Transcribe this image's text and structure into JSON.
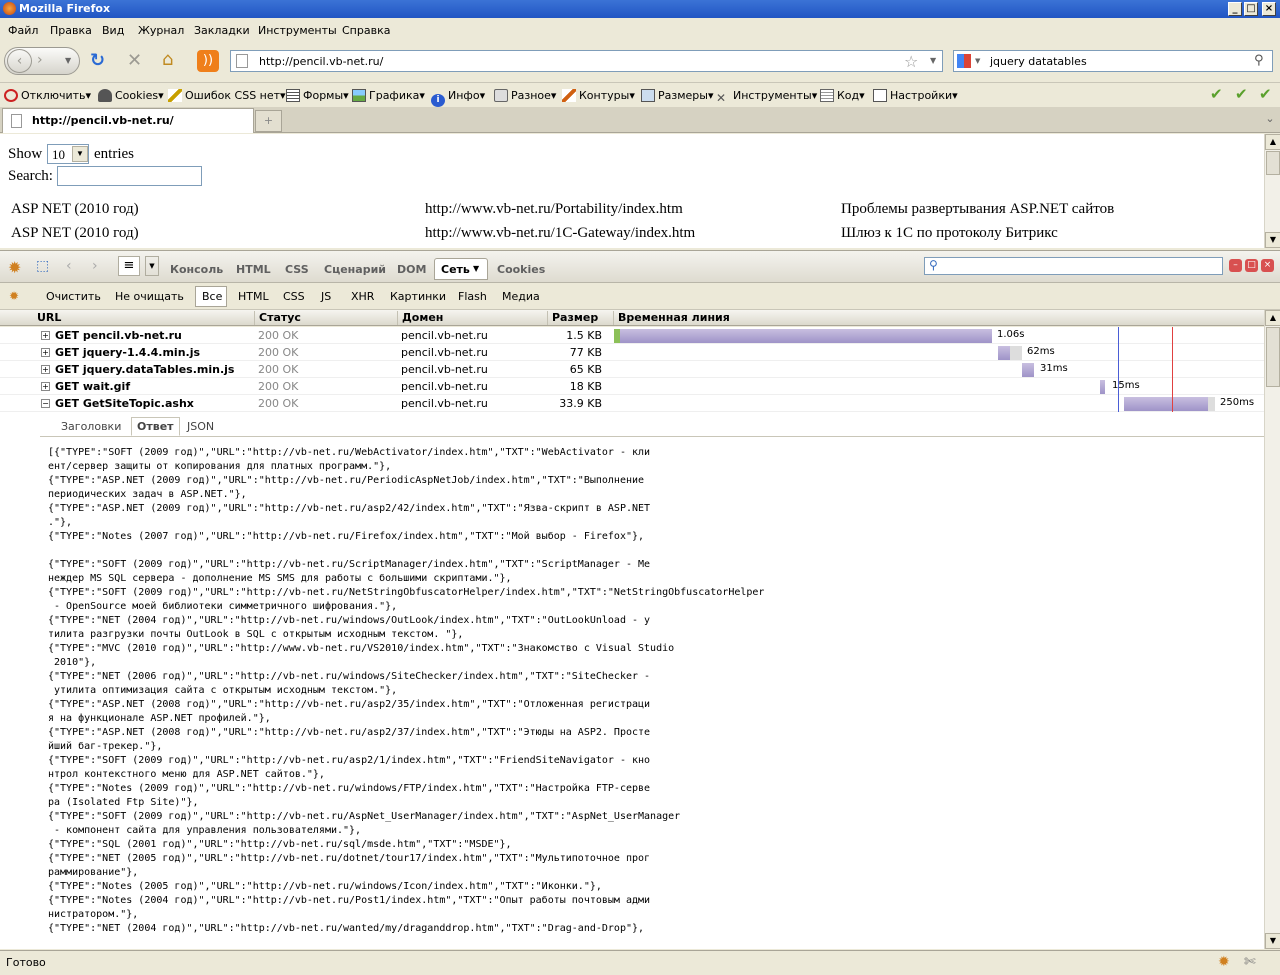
{
  "window": {
    "title": "Mozilla Firefox"
  },
  "menu": [
    "Файл",
    "Правка",
    "Вид",
    "Журнал",
    "Закладки",
    "Инструменты",
    "Справка"
  ],
  "nav": {
    "url": "http://pencil.vb-net.ru/",
    "search": "jquery datatables"
  },
  "toolbar2": [
    "Отключить",
    "Cookies",
    "Ошибок CSS нет",
    "Формы",
    "Графика",
    "Инфо",
    "Разное",
    "Контуры",
    "Размеры",
    "Инструменты",
    "Код",
    "Настройки"
  ],
  "tab": {
    "label": "http://pencil.vb-net.ru/"
  },
  "page": {
    "show": "Show",
    "entries": "entries",
    "select_value": "10",
    "search_label": "Search:",
    "rows": [
      [
        "ASP NET (2010 год)",
        "http://www.vb-net.ru/Portability/index.htm",
        "Проблемы развертывания ASP.NET сайтов"
      ],
      [
        "ASP NET (2010 год)",
        "http://www.vb-net.ru/1C-Gateway/index.htm",
        "Шлюз к 1C по протоколу Битрикс"
      ]
    ]
  },
  "firebug": {
    "tabs": [
      "Консоль",
      "HTML",
      "CSS",
      "Сценарий",
      "DOM",
      "Сеть",
      "Cookies"
    ],
    "active_tab": "Сеть",
    "filters": [
      "Очистить",
      "Не очищать",
      "Все",
      "HTML",
      "CSS",
      "JS",
      "XHR",
      "Картинки",
      "Flash",
      "Медиа"
    ],
    "columns": [
      "URL",
      "Статус",
      "Домен",
      "Размер",
      "Временная линия"
    ],
    "requests": [
      {
        "url": "GET pencil.vb-net.ru",
        "status": "200 OK",
        "domain": "pencil.vb-net.ru",
        "size": "1.5 KB",
        "time": "1.06s",
        "sign": "+"
      },
      {
        "url": "GET jquery-1.4.4.min.js",
        "status": "200 OK",
        "domain": "pencil.vb-net.ru",
        "size": "77 KB",
        "time": "62ms",
        "sign": "+"
      },
      {
        "url": "GET jquery.dataTables.min.js",
        "status": "200 OK",
        "domain": "pencil.vb-net.ru",
        "size": "65 KB",
        "time": "31ms",
        "sign": "+"
      },
      {
        "url": "GET wait.gif",
        "status": "200 OK",
        "domain": "pencil.vb-net.ru",
        "size": "18 KB",
        "time": "15ms",
        "sign": "+"
      },
      {
        "url": "GET GetSiteTopic.ashx",
        "status": "200 OK",
        "domain": "pencil.vb-net.ru",
        "size": "33.9 KB",
        "time": "250ms",
        "sign": "−"
      }
    ],
    "subtabs": [
      "Заголовки",
      "Ответ",
      "JSON"
    ],
    "response": "[{\"TYPE\":\"SOFT (2009 год)\",\"URL\":\"http://vb-net.ru/WebActivator/index.htm\",\"TXT\":\"WebActivator - кли\nент/сервер защиты от копирования для платных программ.\"},\n{\"TYPE\":\"ASP.NET (2009 год)\",\"URL\":\"http://vb-net.ru/PeriodicAspNetJob/index.htm\",\"TXT\":\"Выполнение\nпериодических задач в ASP.NET.\"},\n{\"TYPE\":\"ASP.NET (2009 год)\",\"URL\":\"http://vb-net.ru/asp2/42/index.htm\",\"TXT\":\"Язва-скрипт в ASP.NET\n.\"},\n{\"TYPE\":\"Notes (2007 год)\",\"URL\":\"http://vb-net.ru/Firefox/index.htm\",\"TXT\":\"Мой выбор - Firefox\"},\n\n{\"TYPE\":\"SOFT (2009 год)\",\"URL\":\"http://vb-net.ru/ScriptManager/index.htm\",\"TXT\":\"ScriptManager - Ме\nнеждер MS SQL сервера - дополнение MS SMS для работы с большими скриптами.\"},\n{\"TYPE\":\"SOFT (2009 год)\",\"URL\":\"http://vb-net.ru/NetStringObfuscatorHelper/index.htm\",\"TXT\":\"NetStringObfuscatorHelper\n - OpenSource моей библиотеки симметричного шифрования.\"},\n{\"TYPE\":\"NET (2004 год)\",\"URL\":\"http://vb-net.ru/windows/OutLook/index.htm\",\"TXT\":\"OutLookUnload - у\nтилита разгрузки почты OutLook в SQL с открытым исходным текстом. \"},\n{\"TYPE\":\"MVC (2010 год)\",\"URL\":\"http://www.vb-net.ru/VS2010/index.htm\",\"TXT\":\"Знакомство с Visual Studio\n 2010\"},\n{\"TYPE\":\"NET (2006 год)\",\"URL\":\"http://vb-net.ru/windows/SiteChecker/index.htm\",\"TXT\":\"SiteChecker -\n утилита оптимизация сайта с открытым исходным текстом.\"},\n{\"TYPE\":\"ASP.NET (2008 год)\",\"URL\":\"http://vb-net.ru/asp2/35/index.htm\",\"TXT\":\"Отложенная регистраци\nя на функционале ASP.NET профилей.\"},\n{\"TYPE\":\"ASP.NET (2008 год)\",\"URL\":\"http://vb-net.ru/asp2/37/index.htm\",\"TXT\":\"Этюды на ASP2. Просте\nйший баг-трекер.\"},\n{\"TYPE\":\"SOFT (2009 год)\",\"URL\":\"http://vb-net.ru/asp2/1/index.htm\",\"TXT\":\"FriendSiteNavigator - кно\nнтрол контекстного меню для ASP.NET сайтов.\"},\n{\"TYPE\":\"Notes (2009 год)\",\"URL\":\"http://vb-net.ru/windows/FTP/index.htm\",\"TXT\":\"Настройка FTP-серве\nра (Isolated Ftp Site)\"},\n{\"TYPE\":\"SOFT (2009 год)\",\"URL\":\"http://vb-net.ru/AspNet_UserManager/index.htm\",\"TXT\":\"AspNet_UserManager\n - компонент сайта для управления пользователями.\"},\n{\"TYPE\":\"SQL (2001 год)\",\"URL\":\"http://vb-net.ru/sql/msde.htm\",\"TXT\":\"MSDE\"},\n{\"TYPE\":\"NET (2005 год)\",\"URL\":\"http://vb-net.ru/dotnet/tour17/index.htm\",\"TXT\":\"Мультипоточное прог\nраммирование\"},\n{\"TYPE\":\"Notes (2005 год)\",\"URL\":\"http://vb-net.ru/windows/Icon/index.htm\",\"TXT\":\"Иконки.\"},\n{\"TYPE\":\"Notes (2004 год)\",\"URL\":\"http://vb-net.ru/Post1/index.htm\",\"TXT\":\"Опыт работы почтовым адми\nнистратором.\"},\n{\"TYPE\":\"NET (2004 год)\",\"URL\":\"http://vb-net.ru/wanted/my/draganddrop.htm\",\"TXT\":\"Drag-and-Drop\"},"
  },
  "status": {
    "text": "Готово"
  },
  "colors": {
    "titlebar": "#2155c3",
    "timeline_bar": "#9e93c8",
    "dom_line": "#4a5dd6",
    "load_line": "#e04040"
  }
}
